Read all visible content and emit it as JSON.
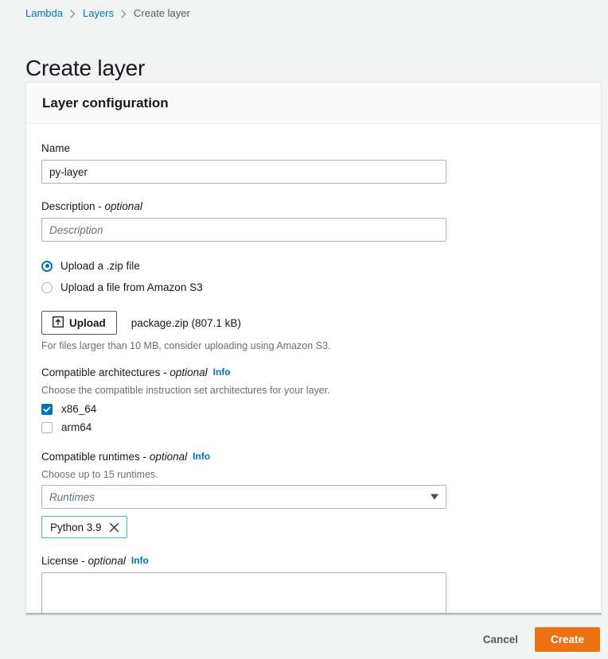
{
  "breadcrumb": {
    "items": [
      {
        "label": "Lambda",
        "current": false
      },
      {
        "label": "Layers",
        "current": false
      },
      {
        "label": "Create layer",
        "current": true
      }
    ]
  },
  "page": {
    "title": "Create layer"
  },
  "card": {
    "header": "Layer configuration"
  },
  "form": {
    "name": {
      "label": "Name",
      "value": "py-layer",
      "placeholder": ""
    },
    "description": {
      "label": "Description - ",
      "label_optional": "optional",
      "value": "",
      "placeholder": "Description"
    },
    "source": {
      "options": [
        {
          "label": "Upload a .zip file",
          "selected": true
        },
        {
          "label": "Upload a file from Amazon S3",
          "selected": false
        }
      ]
    },
    "upload": {
      "button_label": "Upload",
      "icon": "upload-arrow-icon",
      "filename": "package.zip (807.1 kB)",
      "hint": "For files larger than 10 MB, consider uploading using Amazon S3."
    },
    "architectures": {
      "label": "Compatible architectures - ",
      "label_optional": "optional",
      "info_label": "Info",
      "description": "Choose the compatible instruction set architectures for your layer.",
      "options": [
        {
          "label": "x86_64",
          "checked": true
        },
        {
          "label": "arm64",
          "checked": false
        }
      ]
    },
    "runtimes": {
      "label": "Compatible runtimes - ",
      "label_optional": "optional",
      "info_label": "Info",
      "description": "Choose up to 15 runtimes.",
      "select_placeholder": "Runtimes",
      "selected_tokens": [
        {
          "label": "Python 3.9"
        }
      ]
    },
    "license": {
      "label": "License - ",
      "label_optional": "optional",
      "info_label": "Info",
      "value": "",
      "placeholder": ""
    }
  },
  "footer": {
    "cancel_label": "Cancel",
    "create_label": "Create"
  },
  "colors": {
    "accent_blue": "#0073bb",
    "action_orange": "#ec7211",
    "token_border": "#44b9d6",
    "page_background": "#f2f3f3",
    "text_primary": "#16191f",
    "text_secondary": "#687078"
  }
}
